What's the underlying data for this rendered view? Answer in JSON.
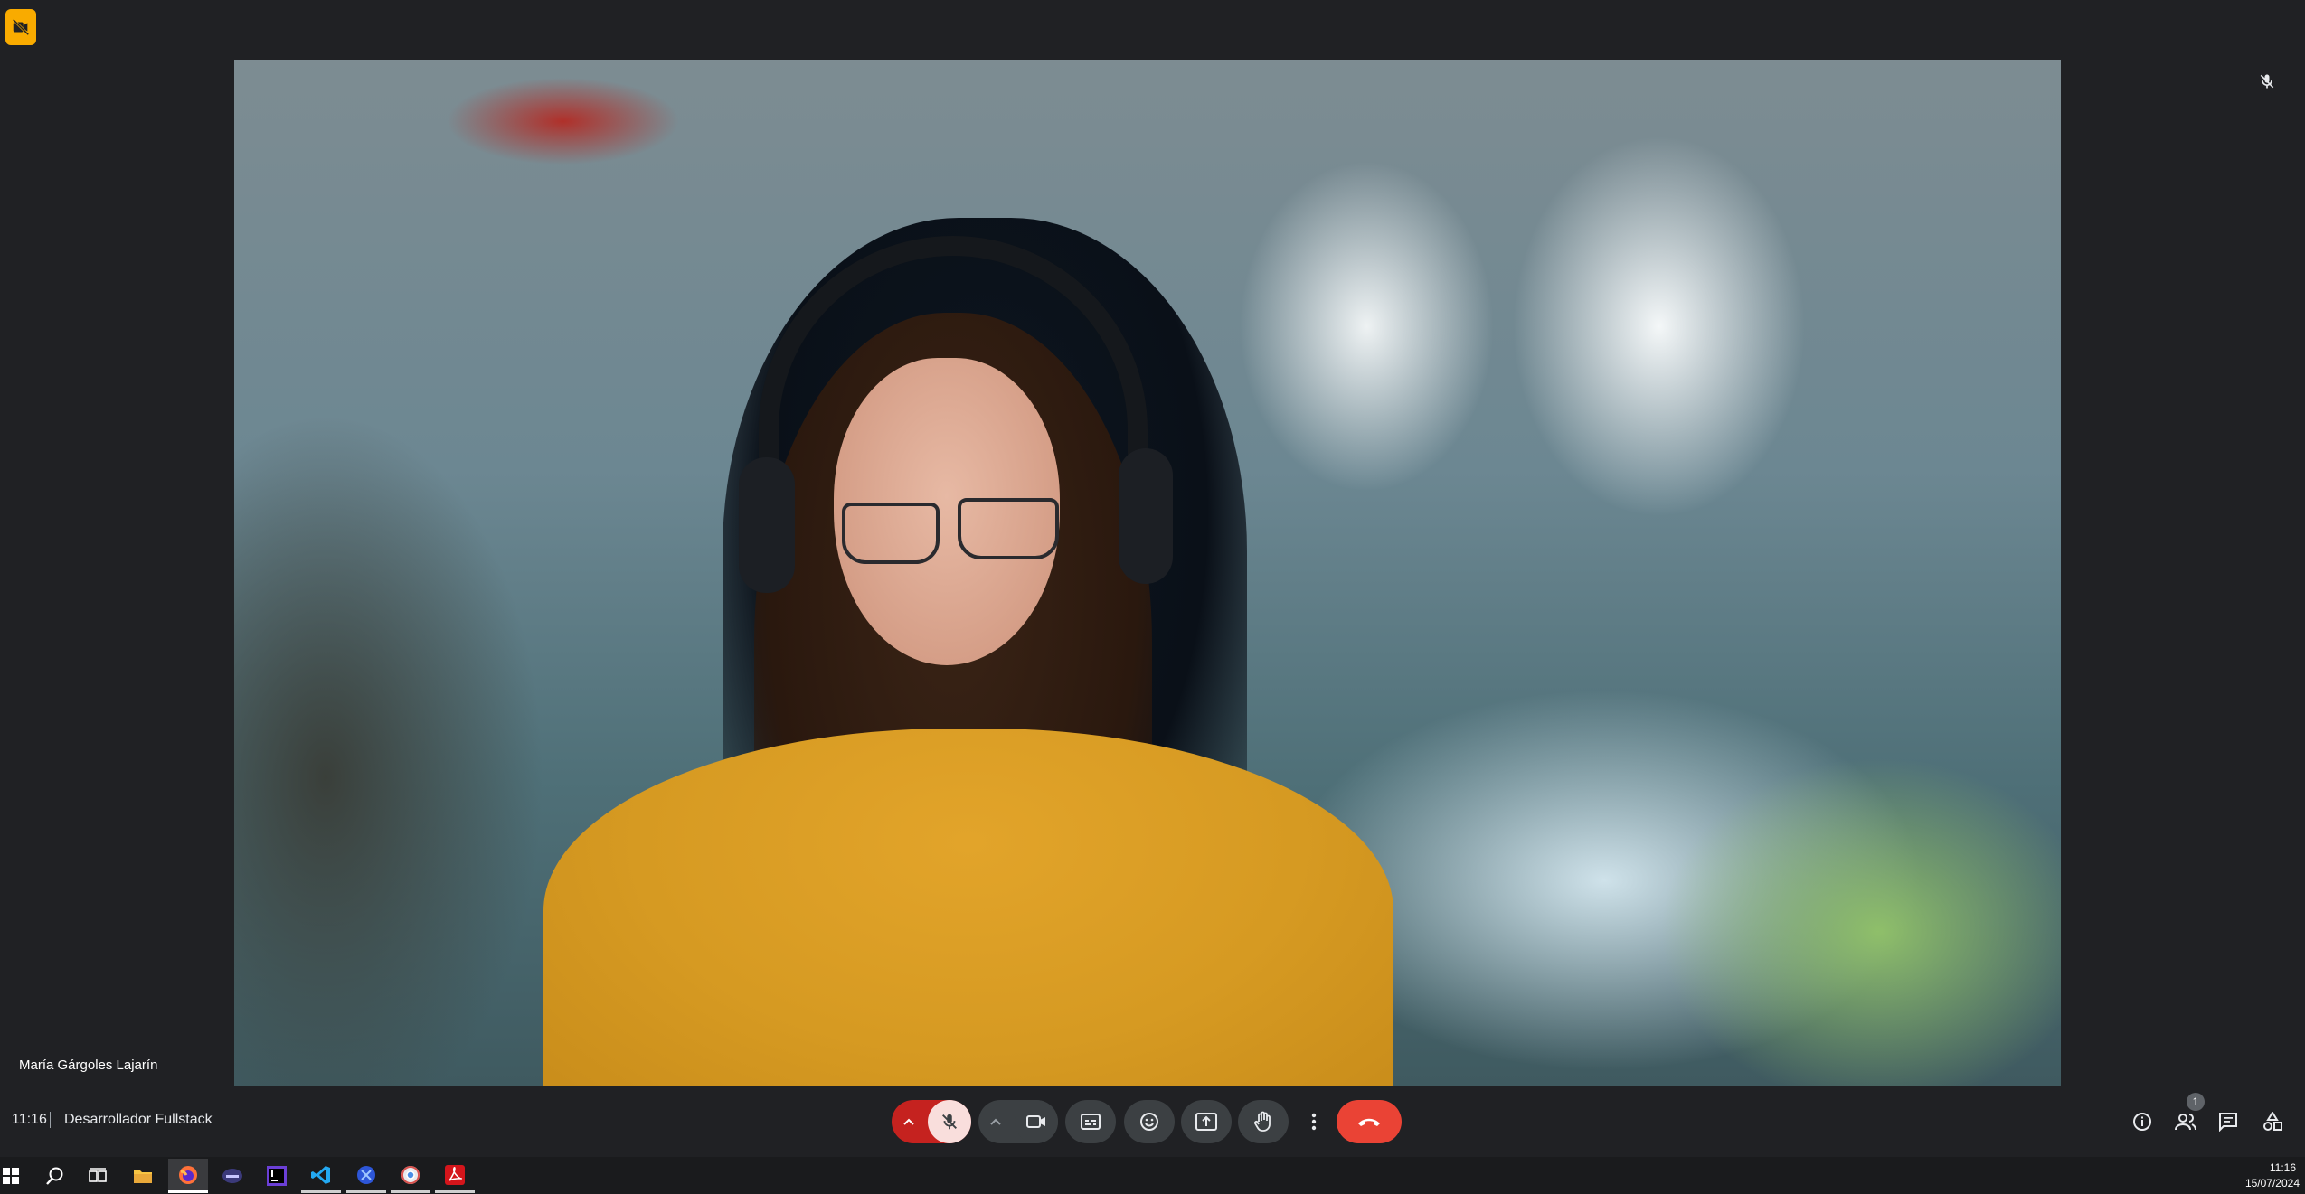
{
  "participant": {
    "name": "María Gárgoles Lajarín"
  },
  "meeting": {
    "time": "11:16",
    "title": "Desarrollador Fullstack"
  },
  "controls": {
    "mic_state": "muted",
    "camera_state": "on",
    "people_count": "1"
  },
  "icons": {
    "camera_off_badge": "camera-off-icon",
    "mic_off": "mic-off-icon",
    "pip": "picture-in-picture-icon",
    "end_call": "end-call-icon"
  },
  "colors": {
    "end_call": "#ea4335",
    "mic_muted_group": "#c5221f",
    "mic_muted_button": "#f9dedc",
    "camera_off_badge": "#f9ab00",
    "background": "#202124"
  },
  "taskbar": {
    "clock_time": "11:16",
    "clock_date": "15/07/2024"
  }
}
